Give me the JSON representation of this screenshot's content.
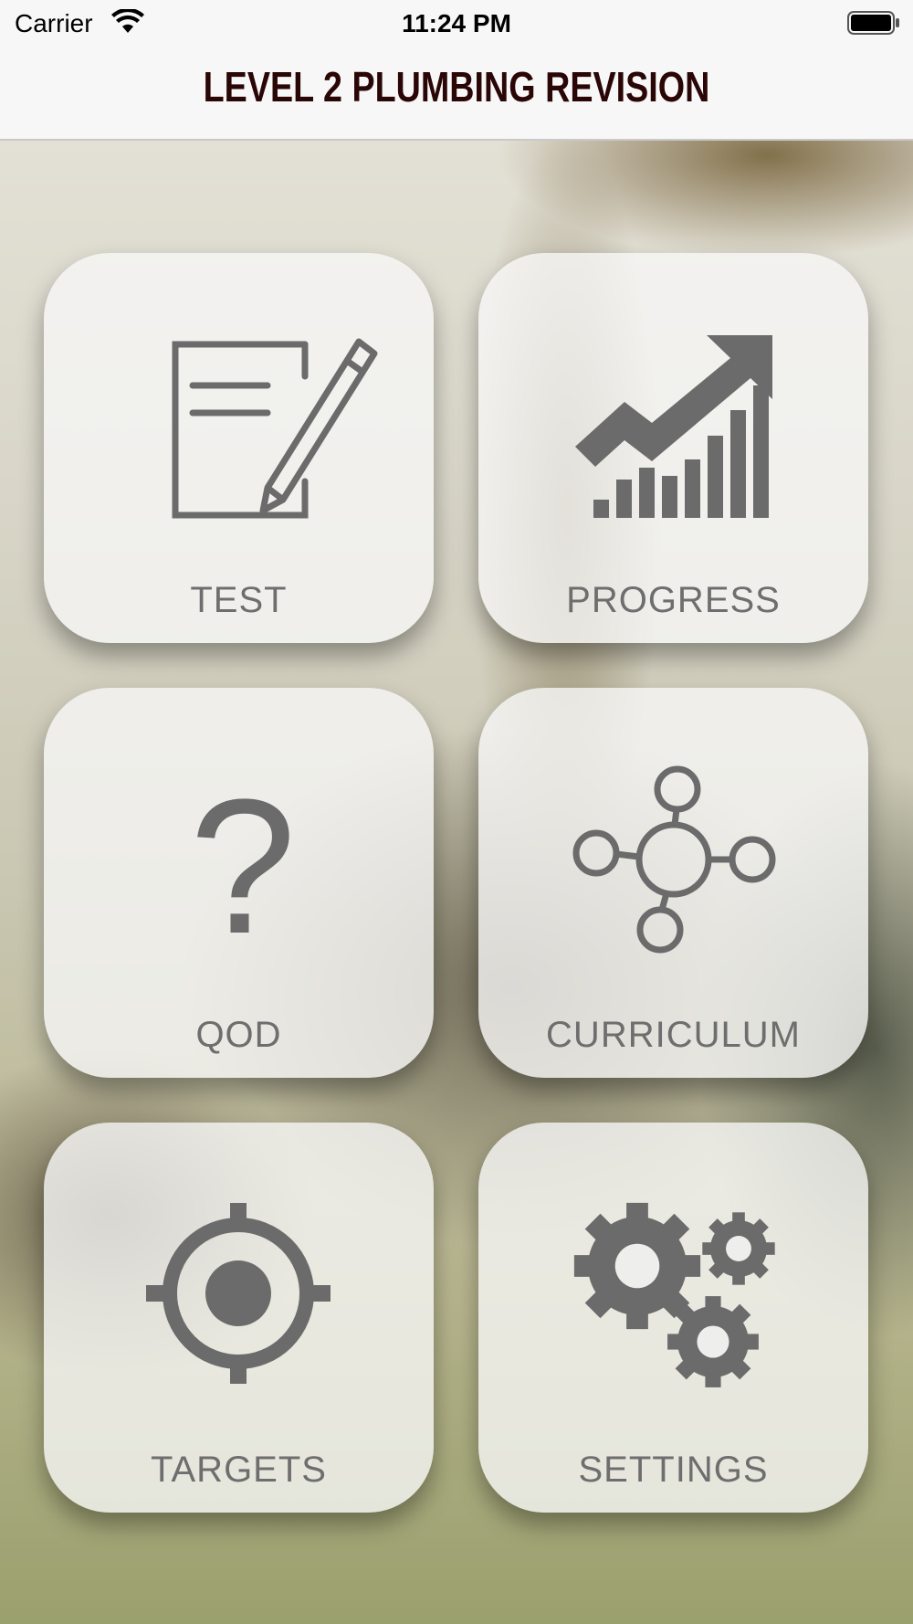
{
  "status_bar": {
    "carrier": "Carrier",
    "time": "11:24 PM",
    "wifi_icon": "wifi-icon",
    "battery_icon": "battery-icon"
  },
  "header": {
    "title": "LEVEL 2 PLUMBING REVISION"
  },
  "menu": {
    "tiles": [
      {
        "label": "TEST",
        "icon": "note-pencil-icon"
      },
      {
        "label": "PROGRESS",
        "icon": "chart-growth-icon"
      },
      {
        "label": "QOD",
        "icon": "question-mark-icon"
      },
      {
        "label": "CURRICULUM",
        "icon": "network-nodes-icon"
      },
      {
        "label": "TARGETS",
        "icon": "crosshair-target-icon"
      },
      {
        "label": "SETTINGS",
        "icon": "gears-icon"
      }
    ]
  },
  "colors": {
    "title": "#2a0606",
    "icon": "#6b6b6b",
    "label": "#6e6e6e",
    "tile_bg": "#f7f7f7"
  }
}
